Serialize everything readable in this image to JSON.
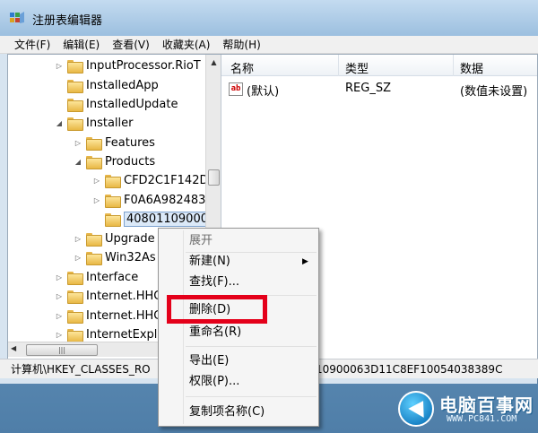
{
  "window": {
    "title": "注册表编辑器",
    "status_path_left": "计算机\\HKEY_CLASSES_RO",
    "status_path_right": "10900063D11C8EF10054038389C"
  },
  "menu": [
    "文件(F)",
    "编辑(E)",
    "查看(V)",
    "收藏夹(A)",
    "帮助(H)"
  ],
  "tree": [
    {
      "label": "InputProcessor.RioT",
      "arrow": "▷"
    },
    {
      "label": "InstalledApp",
      "arrow": ""
    },
    {
      "label": "InstalledUpdate",
      "arrow": ""
    },
    {
      "label": "Installer",
      "arrow": "◢"
    },
    {
      "label": "Features",
      "arrow": "▷"
    },
    {
      "label": "Products",
      "arrow": "◢"
    },
    {
      "label": "CFD2C1F142D",
      "arrow": "▷"
    },
    {
      "label": "F0A6A982483",
      "arrow": "▷"
    },
    {
      "label": "40801109000",
      "arrow": ""
    },
    {
      "label": "Upgrade",
      "arrow": "▷"
    },
    {
      "label": "Win32As",
      "arrow": "▷"
    },
    {
      "label": "Interface",
      "arrow": "▷"
    },
    {
      "label": "Internet.HHC",
      "arrow": "▷"
    },
    {
      "label": "Internet.HHC",
      "arrow": "▷"
    },
    {
      "label": "InternetExpl",
      "arrow": "▷"
    }
  ],
  "list": {
    "headers": [
      "名称",
      "类型",
      "数据"
    ],
    "rows": [
      {
        "name": "(默认)",
        "type": "REG_SZ",
        "data": "(数值未设置)"
      }
    ]
  },
  "context_menu": {
    "items": [
      {
        "label": "展开",
        "disabled": true
      },
      {
        "label": "新建(N)",
        "submenu": true
      },
      {
        "label": "查找(F)..."
      },
      {
        "label": "删除(D)"
      },
      {
        "label": "重命名(R)"
      },
      {
        "label": "导出(E)"
      },
      {
        "label": "权限(P)..."
      },
      {
        "label": "复制项名称(C)"
      }
    ]
  },
  "logo": {
    "name": "电脑百事网",
    "url": "WWW.PC841.COM"
  },
  "colors": {
    "highlight": "#e4001a",
    "selection": "#dbe9f8"
  }
}
